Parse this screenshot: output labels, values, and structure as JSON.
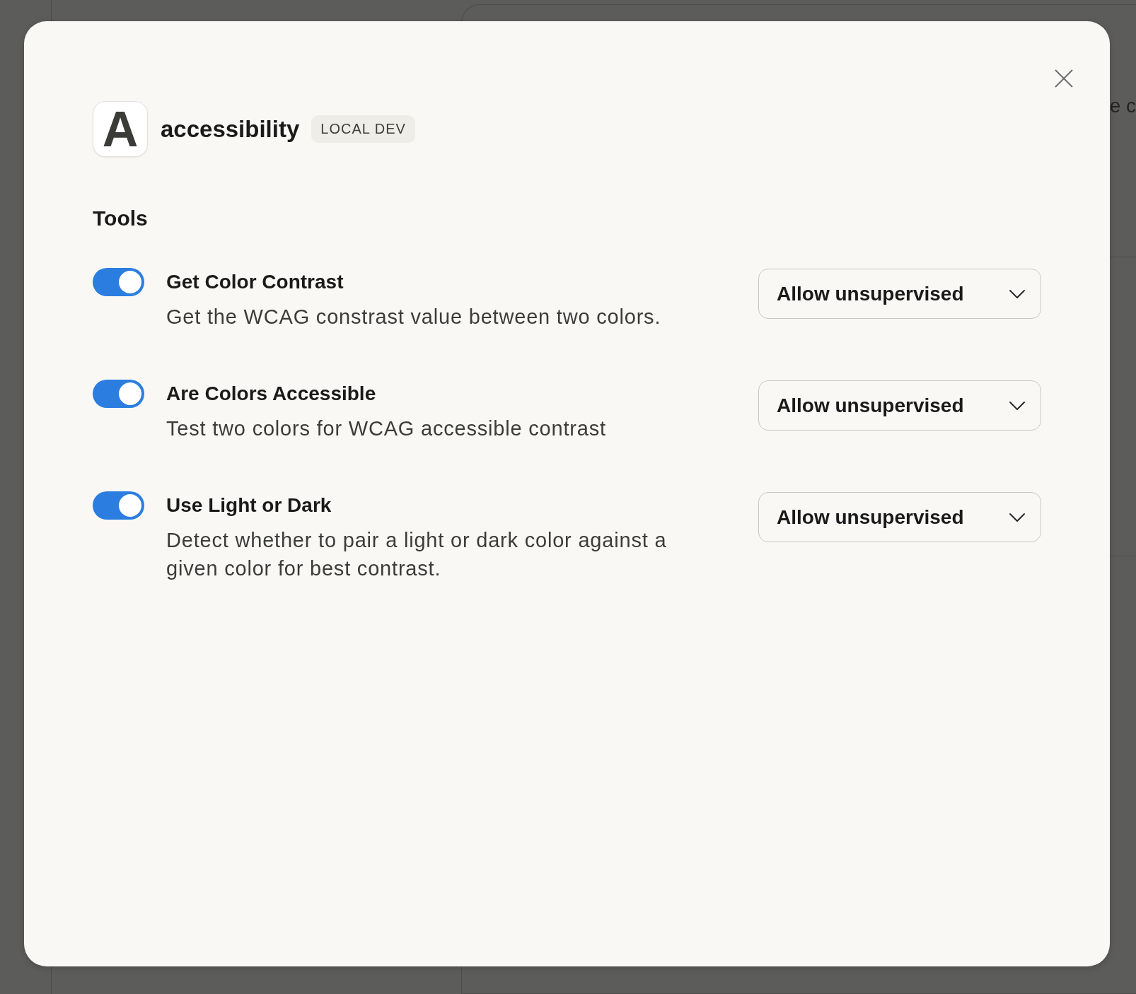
{
  "background": {
    "text_fragment": "e c"
  },
  "dialog": {
    "app": {
      "logo_letter": "A",
      "name": "accessibility",
      "badge": "LOCAL DEV"
    },
    "section_title": "Tools",
    "tools": [
      {
        "name": "Get Color Contrast",
        "description": "Get the WCAG constrast value between two colors.",
        "enabled": true,
        "permission": "Allow unsupervised"
      },
      {
        "name": "Are Colors Accessible",
        "description": "Test two colors for WCAG accessible contrast",
        "enabled": true,
        "permission": "Allow unsupervised"
      },
      {
        "name": "Use Light or Dark",
        "description": "Detect whether to pair a light or dark color against a given color for best contrast.",
        "enabled": true,
        "permission": "Allow unsupervised"
      }
    ]
  }
}
